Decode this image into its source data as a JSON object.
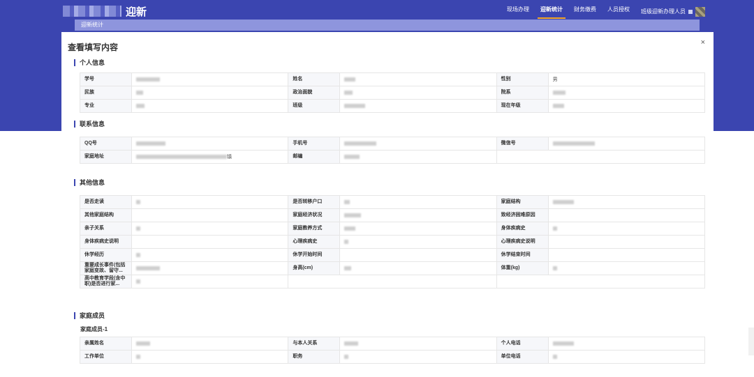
{
  "app": {
    "title": "迎新",
    "nav": [
      "现场办理",
      "迎新统计",
      "财务缴费",
      "人员授权"
    ],
    "active_nav": "迎新统计",
    "user": "班级迎新办理人员",
    "subtab": "迎新统计"
  },
  "modal": {
    "title": "查看填写内容",
    "close": "×"
  },
  "personal": {
    "title": "个人信息",
    "rows": [
      [
        {
          "label": "学号",
          "value": ""
        },
        {
          "label": "姓名",
          "value": ""
        },
        {
          "label": "性别",
          "value": "男"
        }
      ],
      [
        {
          "label": "民族",
          "value": ""
        },
        {
          "label": "政治面貌",
          "value": ""
        },
        {
          "label": "院系",
          "value": ""
        }
      ],
      [
        {
          "label": "专业",
          "value": ""
        },
        {
          "label": "班级",
          "value": ""
        },
        {
          "label": "现在年级",
          "value": ""
        }
      ]
    ]
  },
  "contact": {
    "title": "联系信息",
    "rows": [
      [
        {
          "label": "QQ号",
          "value": ""
        },
        {
          "label": "手机号",
          "value": ""
        },
        {
          "label": "微信号",
          "value": ""
        }
      ],
      [
        {
          "label": "家庭地址",
          "value": "镇"
        },
        {
          "label": "邮编",
          "value": ""
        }
      ]
    ]
  },
  "other": {
    "title": "其他信息",
    "rows": [
      [
        {
          "label": "是否走读",
          "value": ""
        },
        {
          "label": "是否转移户口",
          "value": ""
        },
        {
          "label": "家庭结构",
          "value": ""
        }
      ],
      [
        {
          "label": "其他家庭结构",
          "value": ""
        },
        {
          "label": "家庭经济状况",
          "value": ""
        },
        {
          "label": "致经济困难原因",
          "value": ""
        }
      ],
      [
        {
          "label": "亲子关系",
          "value": ""
        },
        {
          "label": "家庭教养方式",
          "value": ""
        },
        {
          "label": "身体疾病史",
          "value": ""
        }
      ],
      [
        {
          "label": "身体疾病史说明",
          "value": ""
        },
        {
          "label": "心理疾病史",
          "value": ""
        },
        {
          "label": "心理疾病史说明",
          "value": ""
        }
      ],
      [
        {
          "label": "休学经历",
          "value": ""
        },
        {
          "label": "休学开始时间",
          "value": ""
        },
        {
          "label": "休学结束时间",
          "value": ""
        }
      ],
      [
        {
          "label": "重要成长事件(包括家庭变故、留守...",
          "value": ""
        },
        {
          "label": "身高(cm)",
          "value": ""
        },
        {
          "label": "体重(kg)",
          "value": ""
        }
      ],
      [
        {
          "label": "高中教育学段(含中职)是否进行家...",
          "value": ""
        }
      ]
    ]
  },
  "family": {
    "title": "家庭成员",
    "member_title": "家庭成员-1",
    "rows": [
      [
        {
          "label": "亲属姓名",
          "value": ""
        },
        {
          "label": "与本人关系",
          "value": ""
        },
        {
          "label": "个人电话",
          "value": ""
        }
      ],
      [
        {
          "label": "工作单位",
          "value": ""
        },
        {
          "label": "职务",
          "value": ""
        },
        {
          "label": "单位电话",
          "value": ""
        }
      ]
    ]
  }
}
